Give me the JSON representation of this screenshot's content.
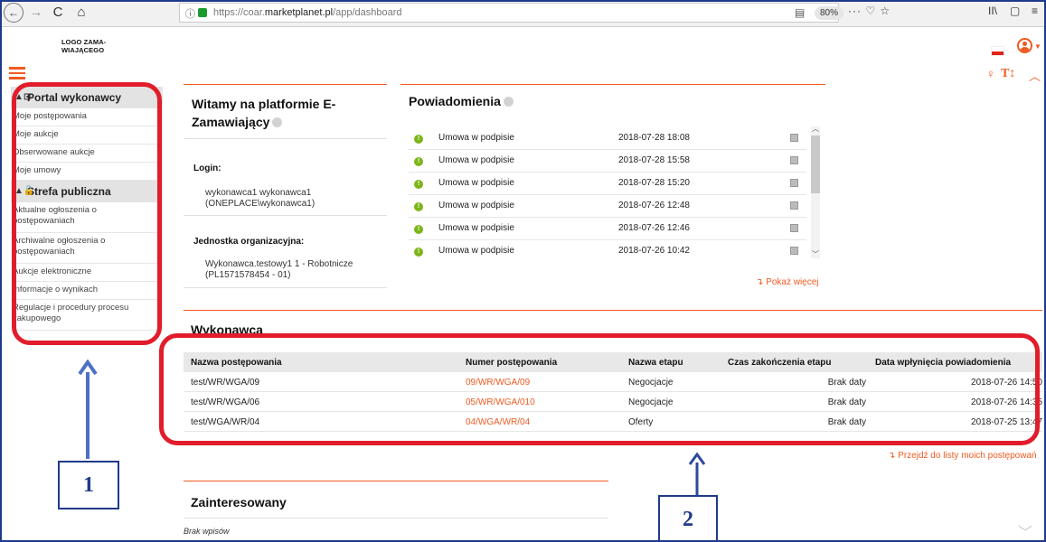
{
  "browser": {
    "url_host": "https://coar.",
    "url_domain": "marketplanet.pl",
    "url_path": "/app/dashboard",
    "zoom": "80%",
    "back_glyph": "←",
    "forward_glyph": "→",
    "reload_glyph": "C",
    "home_glyph": "⌂",
    "info_glyph": "ⓘ",
    "reader_glyph": "▤",
    "page_actions": "··· ♡ ☆",
    "library_glyph": "II\\",
    "sidebar_glyph": "▢",
    "menu_glyph": "≡"
  },
  "header": {
    "logo": "LOGO ZAMA-\nWIAJĄCEGO"
  },
  "sidebar": {
    "section1": {
      "title": "Portal wykonawcy"
    },
    "items1": [
      "Moje postępowania",
      "Moje aukcje",
      "Obserwowane aukcje",
      "Moje umowy"
    ],
    "section2": {
      "title": "Strefa publiczna"
    },
    "items2": [
      "Aktualne ogłoszenia o postępowaniach",
      "Archiwalne ogłoszenia o postępowaniach",
      "Aukcje elektroniczne",
      "Informacje o wynikach",
      "Regulacje i procedury procesu zakupowego"
    ]
  },
  "welcome": {
    "title": "Witamy na platformie E-Zamawiający",
    "login_label": "Login:",
    "login_value": "wykonawca1 wykonawca1 (ONEPLACE\\wykonawca1)",
    "unit_label": "Jednostka organizacyjna:",
    "unit_value": "Wykonawca.testowy1 1 - Robotnicze (PL1571578454 - 01)"
  },
  "notifications": {
    "title": "Powiadomienia",
    "rows": [
      {
        "text": "Umowa w podpisie",
        "date": "2018-07-28 18:08"
      },
      {
        "text": "Umowa w podpisie",
        "date": "2018-07-28 15:58"
      },
      {
        "text": "Umowa w podpisie",
        "date": "2018-07-28 15:20"
      },
      {
        "text": "Umowa w podpisie",
        "date": "2018-07-26 12:48"
      },
      {
        "text": "Umowa w podpisie",
        "date": "2018-07-26 12:46"
      },
      {
        "text": "Umowa w podpisie",
        "date": "2018-07-26 10:42"
      }
    ],
    "show_more": "Pokaż więcej"
  },
  "contractor": {
    "title": "Wykonawca",
    "columns": [
      "Nazwa postępowania",
      "Numer postępowania",
      "Nazwa etapu",
      "Czas zakończenia etapu",
      "Data wpłynięcia powiadomienia"
    ],
    "rows": [
      [
        "test/WR/WGA/09",
        "09/WR/WGA/09",
        "Negocjacje",
        "Brak daty",
        "2018-07-26 14:50"
      ],
      [
        "test/WR/WGA/06",
        "05/WR/WGA/010",
        "Negocjacje",
        "Brak daty",
        "2018-07-26 14:35"
      ],
      [
        "test/WGA/WR/04",
        "04/WGA/WR/04",
        "Oferty",
        "Brak daty",
        "2018-07-25 13:47"
      ]
    ],
    "goto_list": "Przejdź do listy moich postępowań"
  },
  "interested": {
    "title": "Zainteresowany",
    "empty": "Brak wpisów"
  },
  "annotations": {
    "label1": "1",
    "label2": "2"
  },
  "colors": {
    "accent": "#f15a22",
    "callout": "#e11d2b",
    "annotation_blue": "#1f3a8a"
  }
}
